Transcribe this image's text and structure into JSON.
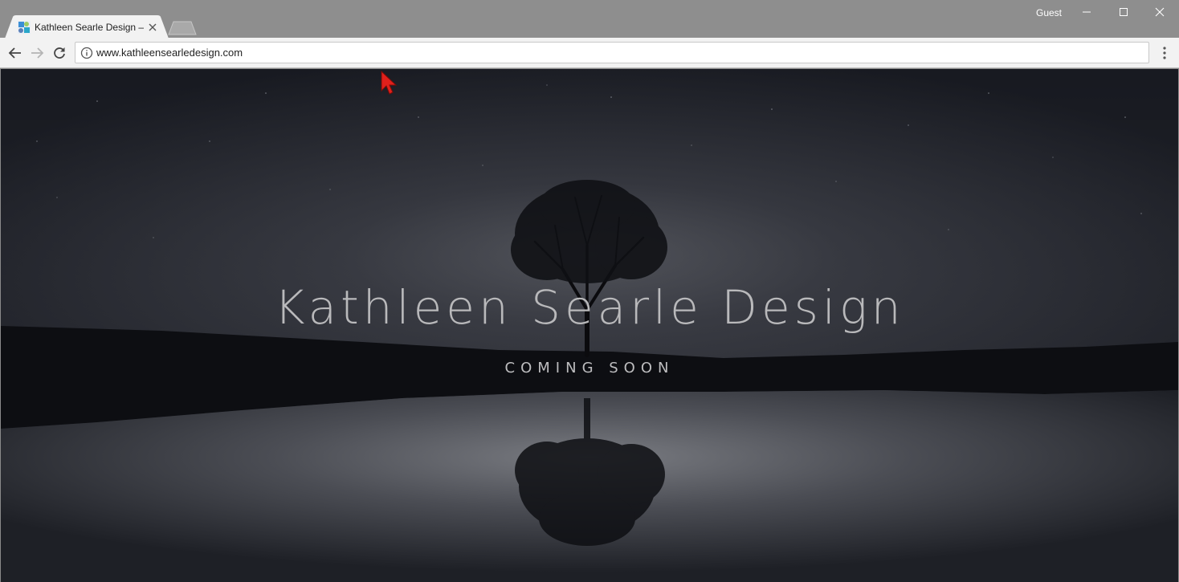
{
  "window": {
    "profile_label": "Guest"
  },
  "tabs": [
    {
      "title": "Kathleen Searle Design –",
      "active": true
    }
  ],
  "toolbar": {
    "url": "www.kathleensearledesign.com"
  },
  "page": {
    "headline": "Kathleen Searle Design",
    "subheadline": "COMING SOON"
  },
  "colors": {
    "accent_cursor": "#e0201b",
    "headline_text": "#b9b9bb"
  }
}
